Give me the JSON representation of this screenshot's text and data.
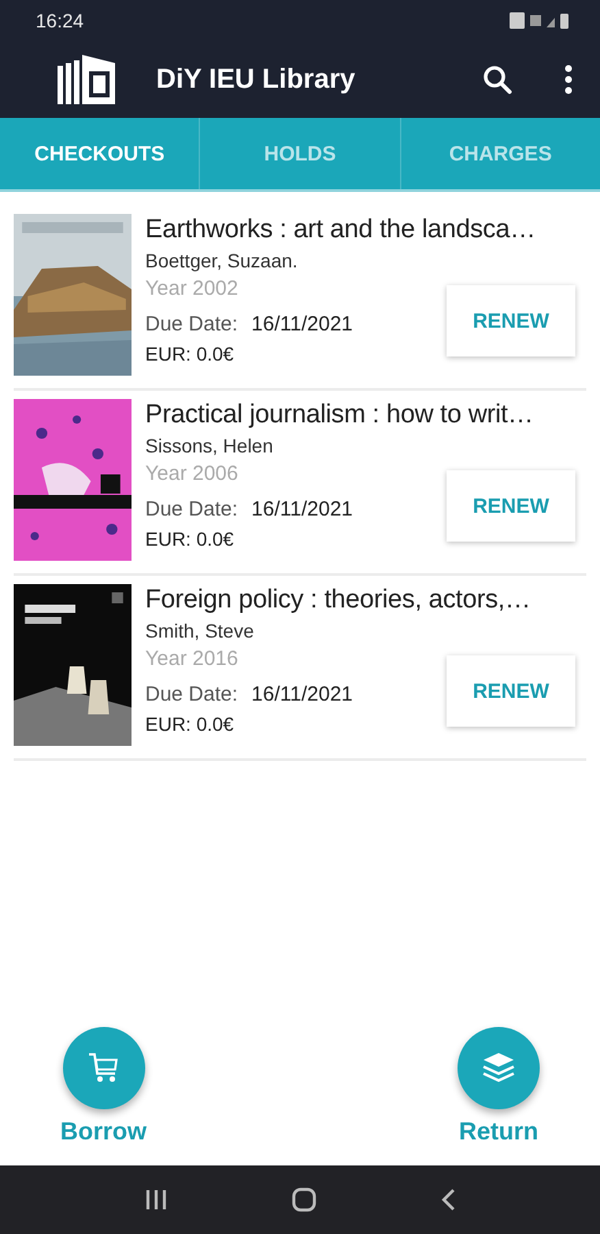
{
  "status_bar": {
    "time": "16:24"
  },
  "app_bar": {
    "title": "DiY IEU Library"
  },
  "tabs": [
    {
      "label": "CHECKOUTS",
      "selected": true
    },
    {
      "label": "HOLDS",
      "selected": false
    },
    {
      "label": "CHARGES",
      "selected": false
    }
  ],
  "checkouts": [
    {
      "title": "Earthworks : art and the landsca…",
      "author": "Boettger, Suzaan.",
      "year": "Year 2002",
      "due_label": "Due Date:",
      "due_date": "16/11/2021",
      "charge": "EUR: 0.0€",
      "action": "RENEW"
    },
    {
      "title": "Practical journalism : how to writ…",
      "author": "Sissons, Helen",
      "year": "Year 2006",
      "due_label": "Due Date:",
      "due_date": "16/11/2021",
      "charge": "EUR: 0.0€",
      "action": "RENEW"
    },
    {
      "title": "Foreign policy : theories, actors,…",
      "author": "Smith, Steve",
      "year": "Year 2016",
      "due_label": "Due Date:",
      "due_date": "16/11/2021",
      "charge": "EUR: 0.0€",
      "action": "RENEW"
    }
  ],
  "actions": [
    {
      "kind": "borrow",
      "label": "Borrow"
    },
    {
      "kind": "return",
      "label": "Return"
    }
  ]
}
